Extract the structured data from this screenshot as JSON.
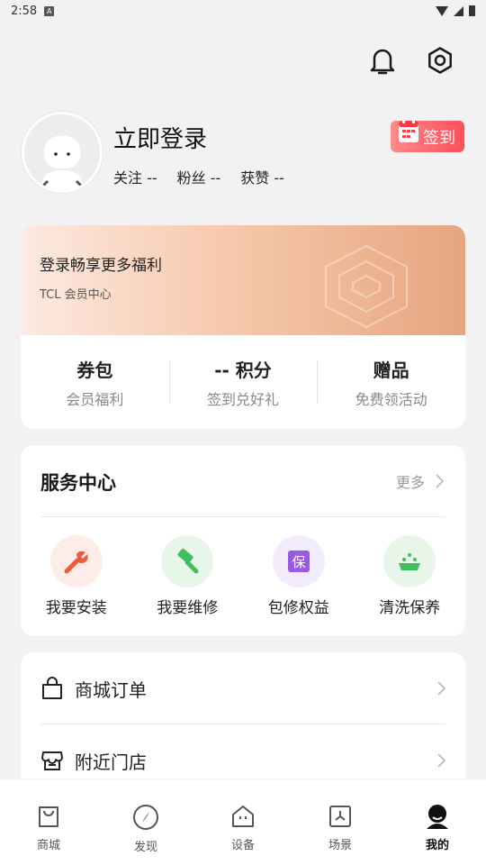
{
  "status_bar": {
    "time": "2:58"
  },
  "profile": {
    "login_label": "立即登录",
    "checkin_label": "签到",
    "stats": [
      {
        "label": "关注 --"
      },
      {
        "label": "粉丝 --"
      },
      {
        "label": "获赞 --"
      }
    ]
  },
  "member": {
    "title": "登录畅享更多福利",
    "subtitle": "TCL 会员中心",
    "stats": [
      {
        "value": "券包",
        "label": "会员福利"
      },
      {
        "value": "-- 积分",
        "label": "签到兑好礼"
      },
      {
        "value": "赠品",
        "label": "免费领活动"
      }
    ]
  },
  "service": {
    "title": "服务中心",
    "more_label": "更多",
    "items": [
      {
        "label": "我要安装",
        "icon": "wrench-icon",
        "bg": "#fdece8",
        "color": "#f05a3c"
      },
      {
        "label": "我要维修",
        "icon": "hammer-icon",
        "bg": "#e8f6ea",
        "color": "#3fbf5c"
      },
      {
        "label": "包修权益",
        "icon": "warranty-icon",
        "bg": "#f1ebfb",
        "color": "#9a5be0",
        "glyph": "保"
      },
      {
        "label": "清洗保养",
        "icon": "cleaning-icon",
        "bg": "#e8f6ea",
        "color": "#3fbf5c"
      }
    ]
  },
  "list": [
    {
      "label": "商城订单",
      "icon": "shopping-bag-icon"
    },
    {
      "label": "附近门店",
      "icon": "store-icon"
    }
  ],
  "tabs": [
    {
      "label": "商城",
      "icon": "bag-tab-icon"
    },
    {
      "label": "发现",
      "icon": "compass-icon"
    },
    {
      "label": "设备",
      "icon": "home-device-icon"
    },
    {
      "label": "场景",
      "icon": "scene-icon"
    },
    {
      "label": "我的",
      "icon": "profile-icon",
      "active": true
    }
  ],
  "colors": {
    "accent": "#ff4f5a",
    "background": "#f2f2f5"
  }
}
